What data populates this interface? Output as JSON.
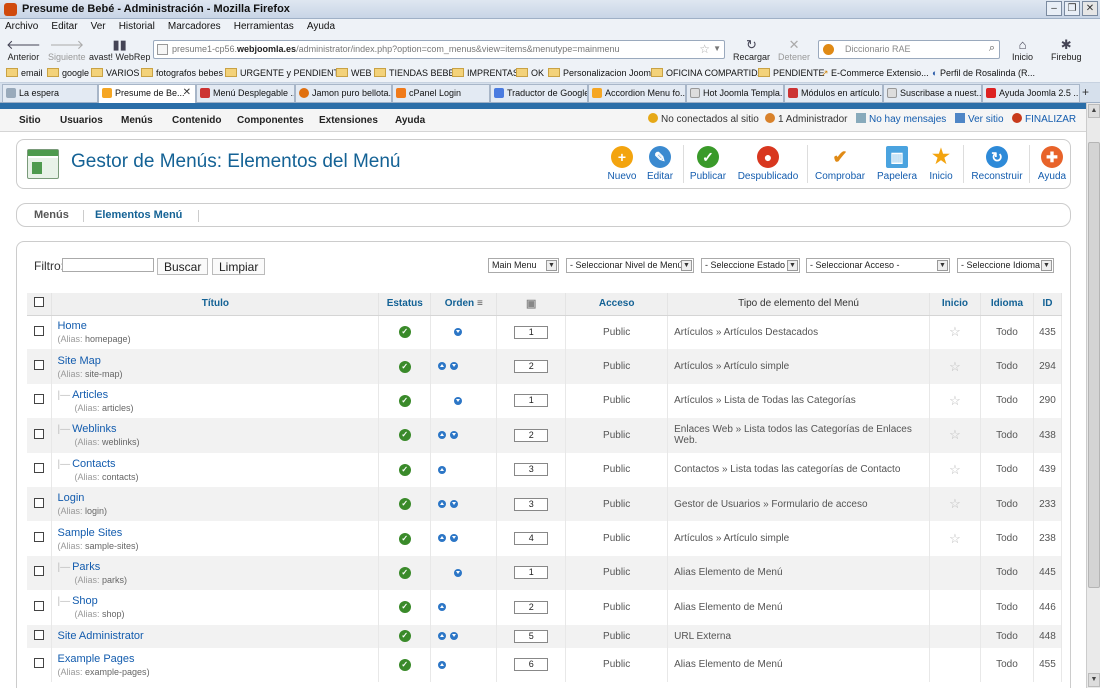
{
  "window": {
    "title": "Presume de Bebé - Administración - Mozilla Firefox"
  },
  "menubar": [
    "Archivo",
    "Editar",
    "Ver",
    "Historial",
    "Marcadores",
    "Herramientas",
    "Ayuda"
  ],
  "nav": {
    "back": "Anterior",
    "forward": "Siguiente",
    "avast": "avast! WebRep",
    "url_prefix": "presume1-cp56.",
    "url_domain": "webjoomla.es",
    "url_path": "/administrator/index.php?option=com_menus&view=items&menutype=mainmenu",
    "reload": "Recargar",
    "stop": "Detener",
    "search_placeholder": "Diccionario RAE",
    "home": "Inicio",
    "firebug": "Firebug"
  },
  "bookmarks": [
    "email",
    "google",
    "VARIOS",
    "fotografos bebes",
    "URGENTE y PENDIENTE",
    "WEB",
    "TIENDAS BEBES",
    "IMPRENTAS",
    "OK",
    "Personalizacion Joomla",
    "OFICINA COMPARTIDA",
    "PENDIENTE",
    "E-Commerce Extensio...",
    "Perfil de Rosalinda (R..."
  ],
  "tabs": [
    "La espera",
    "Presume de Be...",
    "Menú Desplegable ...",
    "Jamon puro bellota...",
    "cPanel Login",
    "Traductor de Google",
    "Accordion Menu fo...",
    "Hot Joomla Templa...",
    "Módulos en artículo...",
    "Suscribase a nuest...",
    "Ayuda Joomla 2.5 ..."
  ],
  "joomla_menu": [
    "Sitio",
    "Usuarios",
    "Menús",
    "Contenido",
    "Componentes",
    "Extensiones",
    "Ayuda"
  ],
  "status": {
    "not_connected": "No conectados al sitio",
    "admins": "1 Administrador",
    "messages": "No hay mensajes",
    "view_site": "Ver sitio",
    "logout": "FINALIZAR"
  },
  "page_title": "Gestor de Menús: Elementos del Menú",
  "toolbar": [
    "Nuevo",
    "Editar",
    "Publicar",
    "Despublicado",
    "Comprobar",
    "Papelera",
    "Inicio",
    "Reconstruir",
    "Ayuda"
  ],
  "subnav": [
    "Menús",
    "Elementos Menú"
  ],
  "filter": {
    "label": "Filtro:",
    "search_btn": "Buscar",
    "clear_btn": "Limpiar",
    "selects": [
      "Main Menu",
      "- Seleccionar Nivel de Menú -",
      "- Seleccione Estado -",
      "- Seleccionar Acceso -",
      "- Seleccione Idioma -"
    ]
  },
  "columns": {
    "title": "Título",
    "status": "Estatus",
    "order": "Orden",
    "access": "Acceso",
    "type": "Tipo de elemento del Menú",
    "home": "Inicio",
    "language": "Idioma",
    "id": "ID"
  },
  "alias_label": "(Alias:",
  "rows": [
    {
      "title": "Home",
      "alias": "homepage",
      "order": "1",
      "access": "Public",
      "type": "Artículos » Artículos Destacados",
      "lang": "Todo",
      "id": "435"
    },
    {
      "title": "Site Map",
      "alias": "site-map",
      "order": "2",
      "access": "Public",
      "type": "Artículos » Artículo simple",
      "lang": "Todo",
      "id": "294"
    },
    {
      "title": "Articles",
      "alias": "articles",
      "order": "1",
      "access": "Public",
      "type": "Artículos » Lista de Todas las Categorías",
      "lang": "Todo",
      "id": "290"
    },
    {
      "title": "Weblinks",
      "alias": "weblinks",
      "order": "2",
      "access": "Public",
      "type": "Enlaces Web » Lista todos las Categorías de Enlaces Web.",
      "lang": "Todo",
      "id": "438"
    },
    {
      "title": "Contacts",
      "alias": "contacts",
      "order": "3",
      "access": "Public",
      "type": "Contactos » Lista todas las categorías de Contacto",
      "lang": "Todo",
      "id": "439"
    },
    {
      "title": "Login",
      "alias": "login",
      "order": "3",
      "access": "Public",
      "type": "Gestor de Usuarios » Formulario de acceso",
      "lang": "Todo",
      "id": "233"
    },
    {
      "title": "Sample Sites",
      "alias": "sample-sites",
      "order": "4",
      "access": "Public",
      "type": "Artículos » Artículo simple",
      "lang": "Todo",
      "id": "238"
    },
    {
      "title": "Parks",
      "alias": "parks",
      "order": "1",
      "access": "Public",
      "type": "Alias Elemento de Menú",
      "lang": "Todo",
      "id": "445"
    },
    {
      "title": "Shop",
      "alias": "shop",
      "order": "2",
      "access": "Public",
      "type": "Alias Elemento de Menú",
      "lang": "Todo",
      "id": "446"
    },
    {
      "title": "Site Administrator",
      "alias": "",
      "order": "5",
      "access": "Public",
      "type": "URL Externa",
      "lang": "Todo",
      "id": "448"
    },
    {
      "title": "Example Pages",
      "alias": "example-pages",
      "order": "6",
      "access": "Public",
      "type": "Alias Elemento de Menú",
      "lang": "Todo",
      "id": "455"
    }
  ]
}
